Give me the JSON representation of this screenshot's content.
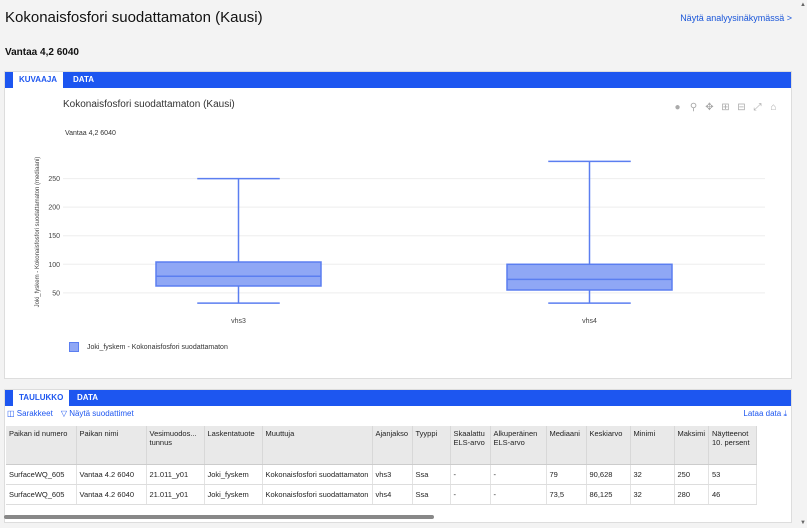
{
  "page": {
    "title": "Kokonaisfosfori suodattamaton (Kausi)",
    "analysis_link": "Näytä analyysinäkymässä >",
    "site": "Vantaa 4,2 6040"
  },
  "chart_panel": {
    "tabs": [
      {
        "label": "KUVAAJA"
      },
      {
        "label": "DATA"
      }
    ],
    "modebar_icons": [
      "camera-icon",
      "zoom-icon",
      "pan-icon",
      "zoom-in-icon",
      "zoom-out-icon",
      "autoscale-icon",
      "reset-axes-icon"
    ]
  },
  "chart_data": {
    "type": "box",
    "title": "Kokonaisfosfori suodattamaton (Kausi)",
    "subtitle": "Vantaa 4,2  6040",
    "ylabel": "Joki_fyskem - Kokonaisfosfori suodattamaton (mediaani)",
    "yticks": [
      50,
      100,
      150,
      200,
      250
    ],
    "ylim": [
      20,
      300
    ],
    "grid": true,
    "categories": [
      "vhs3",
      "vhs4"
    ],
    "series": [
      {
        "name": "Joki_fyskem  - Kokonaisfosfori suodattamaton",
        "color": "#8fa7f5",
        "stroke": "#5b7ef0",
        "boxes": [
          {
            "min": 32,
            "q1": 62,
            "median": 79,
            "q3": 104,
            "max": 250
          },
          {
            "min": 32,
            "q1": 55,
            "median": 73.5,
            "q3": 100,
            "max": 280
          }
        ]
      }
    ],
    "legend_position": "bottom-left"
  },
  "table_panel": {
    "tabs": [
      {
        "label": "TAULUKKO"
      },
      {
        "label": "DATA"
      }
    ],
    "columns_label": "Sarakkeet",
    "filters_label": "Näytä suodattimet",
    "download_label": "Lataa data",
    "headers": [
      "Paikan id numero",
      "Paikan nimi",
      "Vesimuodos... tunnus",
      "Laskentatuote",
      "Muuttuja",
      "Ajanjakso",
      "Tyyppi",
      "Skaalattu ELS-arvo",
      "Alkuperäinen ELS-arvo",
      "Mediaani",
      "Keskiarvo",
      "Minimi",
      "Maksimi",
      "Näytteenot 10. persent"
    ],
    "rows": [
      [
        "SurfaceWQ_605",
        "Vantaa 4.2 6040",
        "21.011_y01",
        "Joki_fyskem",
        "Kokonaisfosfori suodattamaton",
        "vhs3",
        "Ssa",
        "-",
        "-",
        "79",
        "90,628",
        "32",
        "250",
        "53"
      ],
      [
        "SurfaceWQ_605",
        "Vantaa 4.2 6040",
        "21.011_y01",
        "Joki_fyskem",
        "Kokonaisfosfori suodattamaton",
        "vhs4",
        "Ssa",
        "-",
        "-",
        "73,5",
        "86,125",
        "32",
        "280",
        "46"
      ]
    ]
  }
}
